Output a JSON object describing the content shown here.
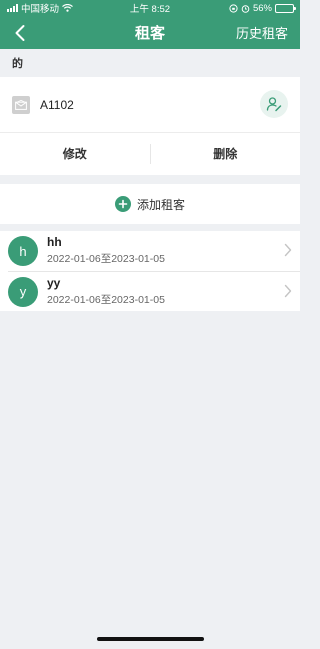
{
  "status_bar": {
    "carrier": "中国移动",
    "time": "上午 8:52",
    "battery": "56%",
    "battery_level": 0.56,
    "icons": [
      "signal-icon",
      "wifi-icon",
      "rotation-lock-icon",
      "alarm-icon",
      "battery-icon"
    ]
  },
  "nav": {
    "title": "租客",
    "history": "历史租客",
    "back_icon": "chevron-left-icon"
  },
  "section": {
    "label": "的"
  },
  "room": {
    "name": "A1102",
    "room_icon": "envelope-icon",
    "user_icon": "user-edit-icon",
    "edit_label": "修改",
    "delete_label": "删除"
  },
  "add_tenant": {
    "label": "添加租客",
    "icon": "plus-circle-icon"
  },
  "tenants": [
    {
      "initial": "h",
      "name": "hh",
      "dates": "2022-01-06至2023-01-05"
    },
    {
      "initial": "y",
      "name": "yy",
      "dates": "2022-01-06至2023-01-05"
    }
  ],
  "colors": {
    "brand": "#3a9c77",
    "background": "#eef0f3"
  }
}
